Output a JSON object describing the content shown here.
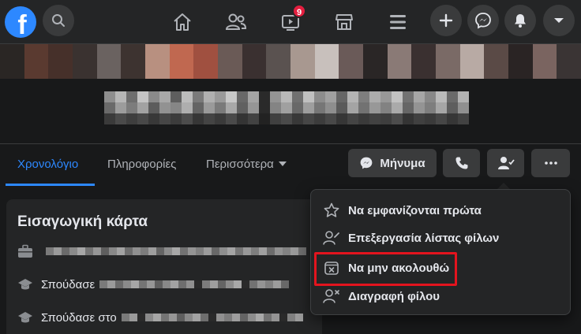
{
  "nav": {
    "logo_letter": "f",
    "video_badge": "9",
    "icons": [
      "search-icon",
      "home-icon",
      "friends-icon",
      "watch-icon",
      "marketplace-icon",
      "menu-icon",
      "plus-icon",
      "messenger-icon",
      "notifications-icon",
      "chevron-down-icon"
    ]
  },
  "tabs": {
    "timeline": "Χρονολόγιο",
    "about": "Πληροφορίες",
    "more": "Περισσότερα"
  },
  "actions": {
    "message_label": "Μήνυμα"
  },
  "intro": {
    "title": "Εισαγωγική κάρτα",
    "studied_label": "Σπούδασε",
    "studied_at_label": "Σπούδασε στο"
  },
  "menu": {
    "items": [
      {
        "label": "Να εμφανίζονται πρώτα"
      },
      {
        "label": "Επεξεργασία λίστας φίλων"
      },
      {
        "label": "Να μην ακολουθώ"
      },
      {
        "label": "Διαγραφή φίλου"
      }
    ]
  },
  "colors": {
    "accent": "#2d88ff",
    "highlight": "#e3141e",
    "badge": "#e41e3f"
  }
}
